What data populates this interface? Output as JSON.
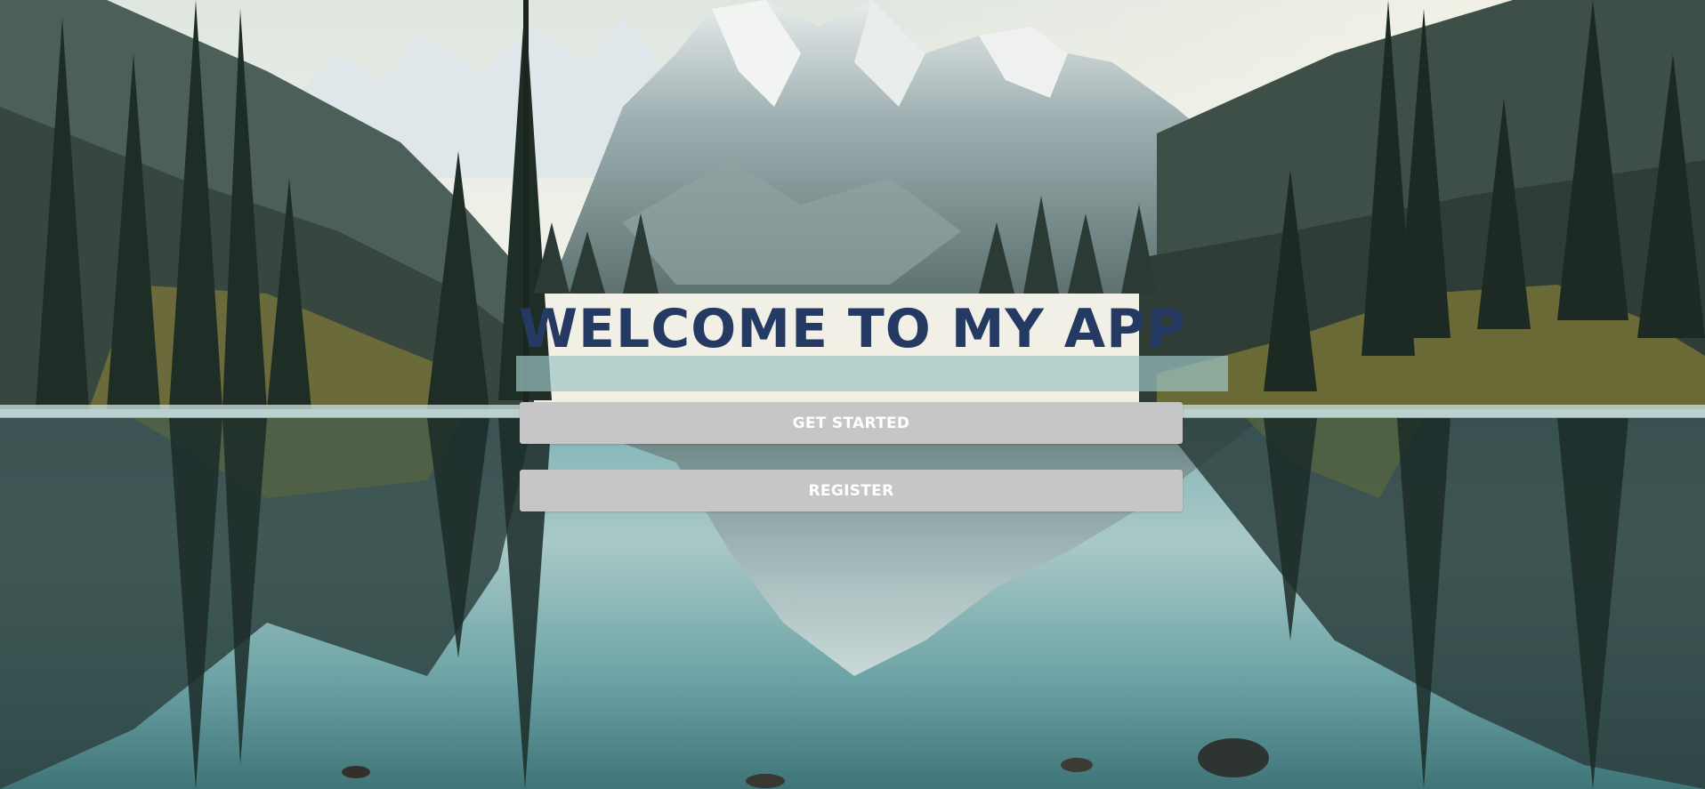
{
  "hero": {
    "title": "WELCOME TO MY APP"
  },
  "actions": {
    "get_started_label": "GET STARTED",
    "register_label": "REGISTER"
  },
  "colors": {
    "title": "#243a62",
    "button_bg": "#c6c6c6",
    "button_text": "#ffffff"
  },
  "background": {
    "icon": "mountain-lake-landscape-image"
  }
}
